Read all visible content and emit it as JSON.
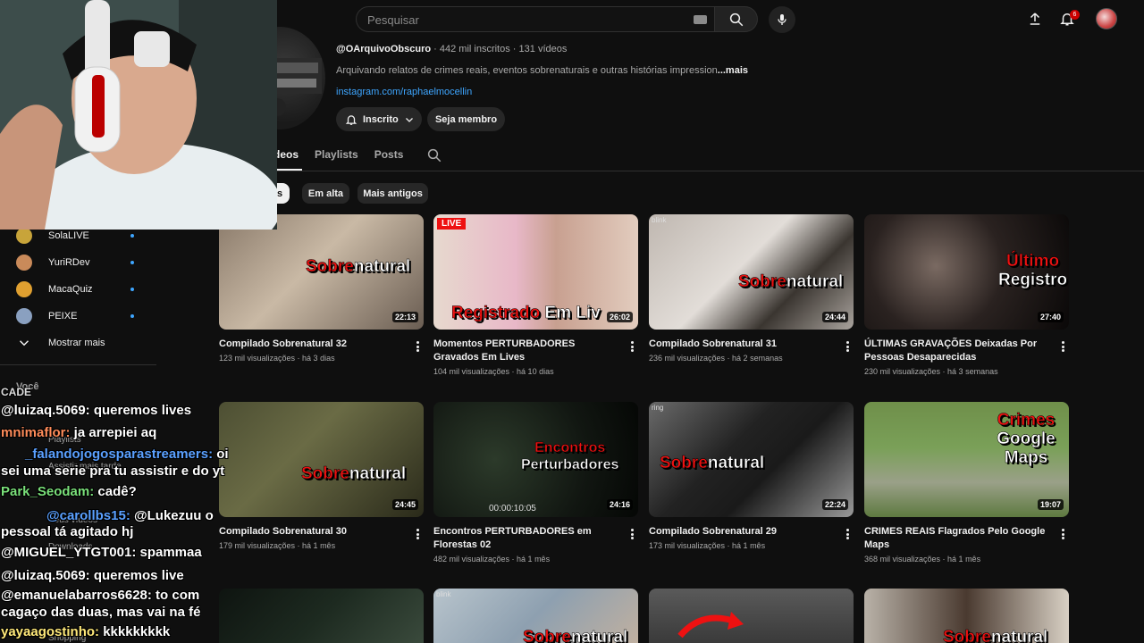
{
  "topbar": {
    "search_placeholder": "Pesquisar",
    "notification_count": "6"
  },
  "channel": {
    "handle": "@OArquivoObscuro",
    "subscribers": "442 mil inscritos",
    "videos_count": "131 vídeos",
    "description": "Arquivando relatos de crimes reais, eventos sobrenaturais e outras histórias impression",
    "more_label": "...mais",
    "link": "instagram.com/raphaelmocellin",
    "subscribed_label": "Inscrito",
    "member_label": "Seja membro"
  },
  "tabs": [
    "Vídeos",
    "Playlists",
    "Posts"
  ],
  "tabs_visible": [
    "deos",
    "Playlists",
    "Posts"
  ],
  "chips": [
    {
      "label": "es",
      "selected": true
    },
    {
      "label": "Em alta",
      "selected": false
    },
    {
      "label": "Mais antigos",
      "selected": false
    }
  ],
  "sidebar": {
    "subscriptions": [
      {
        "name": "SolaLIVE",
        "color": "#c8a43a"
      },
      {
        "name": "YuriRDev",
        "color": "#c98a5a"
      },
      {
        "name": "MacaQuiz",
        "color": "#e0a030"
      },
      {
        "name": "PEIXE",
        "color": "#8aa0c0"
      }
    ],
    "show_more": "Mostrar mais",
    "you_label": "Você",
    "ghost_items": [
      "Playlists",
      "Assistir mais tarde",
      "Seus vídeos",
      "Downloads",
      "Shopping"
    ]
  },
  "videos": [
    {
      "title": "Compilado Sobrenatural 32",
      "views": "123 mil visualizações",
      "age": "há 3 dias",
      "duration": "22:13",
      "overlay_red": "Sobre",
      "overlay_white": "natural"
    },
    {
      "title": "Momentos PERTURBADORES Gravados Em Lives",
      "views": "104 mil visualizações",
      "age": "há 10 dias",
      "duration": "26:02",
      "overlay_red": "Registrado",
      "overlay_white": " Em Liv",
      "live": "LIVE"
    },
    {
      "title": "Compilado Sobrenatural 31",
      "views": "236 mil visualizações",
      "age": "há 2 semanas",
      "duration": "24:44",
      "overlay_red": "Sobre",
      "overlay_white": "natural",
      "watermark": "blink"
    },
    {
      "title": "ÚLTIMAS GRAVAÇÕES Deixadas Por Pessoas Desaparecidas",
      "views": "230 mil visualizações",
      "age": "há 3 semanas",
      "duration": "27:40",
      "overlay_red": "Último",
      "overlay_white": "Registro"
    },
    {
      "title": "Compilado Sobrenatural 30",
      "views": "179 mil visualizações",
      "age": "há 1 mês",
      "duration": "24:45",
      "overlay_red": "Sobre",
      "overlay_white": "natural"
    },
    {
      "title": "Encontros PERTURBADORES em Florestas 02",
      "views": "482 mil visualizações",
      "age": "há 1 mês",
      "duration": "24:16",
      "overlay_red": "Encontros",
      "overlay_white": "Perturbadores",
      "timestamp": "00:00:10:05"
    },
    {
      "title": "Compilado Sobrenatural 29",
      "views": "173 mil visualizações",
      "age": "há 1 mês",
      "duration": "22:24",
      "overlay_red": "Sobre",
      "overlay_white": "natural",
      "watermark": "ring"
    },
    {
      "title": "CRIMES REAIS Flagrados Pelo Google Maps",
      "views": "368 mil visualizações",
      "age": "há 1 mês",
      "duration": "19:07",
      "overlay_red": "Crimes",
      "overlay_white": "Google Maps"
    }
  ],
  "row3_overlays": [
    {
      "watermark": ""
    },
    {
      "watermark": "blink",
      "overlay_red": "Sobre",
      "overlay_white": "natural"
    },
    {
      "watermark": ""
    },
    {
      "overlay_red": "Sobre",
      "overlay_white": "natural"
    }
  ],
  "chat": [
    {
      "user": "",
      "text": "CADE"
    },
    {
      "user": "@luizaq.5069:",
      "text": " queremos lives"
    },
    {
      "user": "mnimaflor:",
      "text": " ja arrepiei aq"
    },
    {
      "user": "_falandojogosparastreamers:",
      "text": " oi"
    },
    {
      "user": "",
      "text": "sei uma serie pra tu assistir e do yt"
    },
    {
      "user": "Park_Seodam:",
      "text": " cadê?"
    },
    {
      "user": "@carollbs15:",
      "text": " @Lukezuu o"
    },
    {
      "user": "",
      "text": "pessoal tá agitado hj"
    },
    {
      "user": "@MIGUEL_YTGT001:",
      "text": " spammaa"
    },
    {
      "user": "@luizaq.5069:",
      "text": " queremos live"
    },
    {
      "user": "@emanuelabarros6628:",
      "text": " to com"
    },
    {
      "user": "",
      "text": "cagaço das duas, mas vai na fé"
    },
    {
      "user": "yayaagostinho:",
      "text": " kkkkkkkkk"
    }
  ],
  "colors": {
    "background": "#0f0f0f",
    "accent_red": "#e11111",
    "link_blue": "#3ea6ff",
    "chip_bg": "#272727"
  }
}
